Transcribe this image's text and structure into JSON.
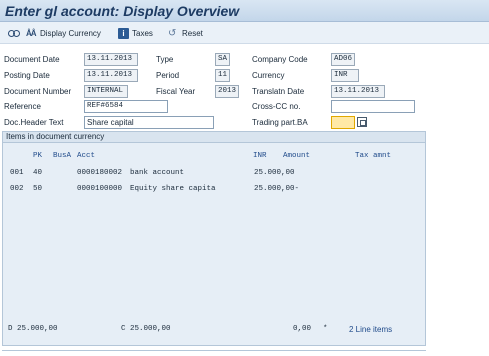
{
  "title": "Enter gl account: Display Overview",
  "toolbar": {
    "display_currency_label": "Display Currency",
    "taxes_label": "Taxes",
    "reset_label": "Reset"
  },
  "header": {
    "document_date": {
      "label": "Document Date",
      "value": "13.11.2013"
    },
    "posting_date": {
      "label": "Posting Date",
      "value": "13.11.2013"
    },
    "document_number": {
      "label": "Document Number",
      "value": "INTERNAL"
    },
    "reference": {
      "label": "Reference",
      "value": "REF#6584"
    },
    "doc_header_text": {
      "label": "Doc.Header Text",
      "value": "Share capital"
    },
    "type": {
      "label": "Type",
      "value": "SA"
    },
    "period": {
      "label": "Period",
      "value": "11"
    },
    "fiscal_year": {
      "label": "Fiscal Year",
      "value": "2013"
    },
    "company_code": {
      "label": "Company Code",
      "value": "AD06"
    },
    "currency": {
      "label": "Currency",
      "value": "INR"
    },
    "translatn_date": {
      "label": "Translatn Date",
      "value": "13.11.2013"
    },
    "cross_cc_no": {
      "label": "Cross-CC no.",
      "value": ""
    },
    "trading_part_ba": {
      "label": "Trading part.BA",
      "value": ""
    }
  },
  "items": {
    "title": "Items in document currency",
    "columns": {
      "pk": "PK",
      "busa": "BusA",
      "acct": "Acct",
      "currency": "INR",
      "amount": "Amount",
      "tax_amnt": "Tax amnt"
    },
    "rows": [
      {
        "line": "001",
        "pk": "40",
        "account": "0000180002",
        "description": "bank account",
        "amount": "25.000,00"
      },
      {
        "line": "002",
        "pk": "50",
        "account": "0000100000",
        "description": "Equity share capita",
        "amount": "25.000,00-"
      }
    ]
  },
  "totals": {
    "debit": "D 25.000,00",
    "credit": "C 25.000,00",
    "balance": "0,00",
    "status_marker": "*",
    "line_items": "2 Line items"
  }
}
